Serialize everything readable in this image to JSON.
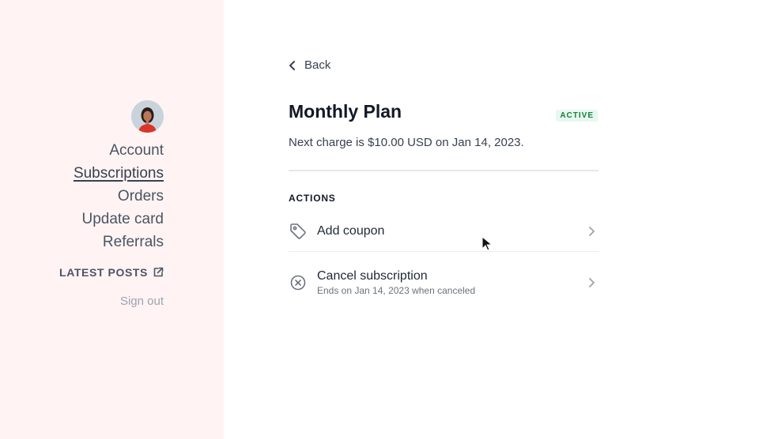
{
  "sidebar": {
    "nav": [
      "Account",
      "Subscriptions",
      "Orders",
      "Update card",
      "Referrals"
    ],
    "active_index": 1,
    "latest_posts": "LATEST POSTS",
    "sign_out": "Sign out"
  },
  "main": {
    "back": "Back",
    "plan_title": "Monthly Plan",
    "status_badge": "ACTIVE",
    "next_charge": "Next charge is $10.00 USD on Jan 14, 2023.",
    "actions_heading": "ACTIONS",
    "actions": [
      {
        "label": "Add coupon",
        "sub": "",
        "icon": "tag-icon"
      },
      {
        "label": "Cancel subscription",
        "sub": "Ends on Jan 14, 2023 when canceled",
        "icon": "x-circle-icon"
      }
    ]
  },
  "colors": {
    "sidebar_bg": "#fff3f3",
    "badge_bg": "#e7f8ee",
    "badge_text": "#15803d"
  }
}
